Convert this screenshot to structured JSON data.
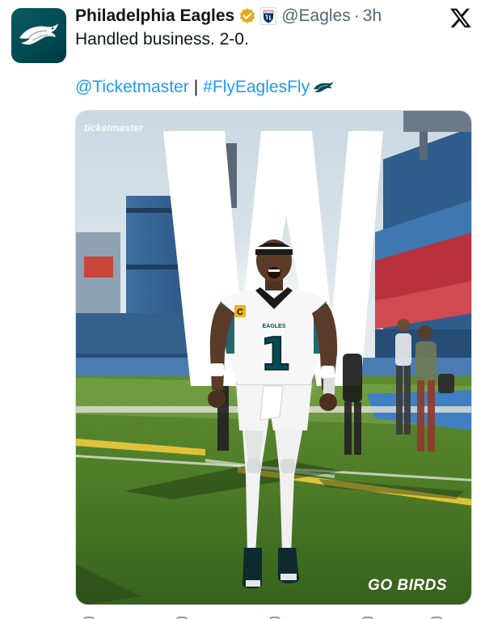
{
  "tweet": {
    "author": {
      "display_name": "Philadelphia Eagles",
      "handle": "@Eagles",
      "verified_badge": "gold-check",
      "affiliate_badge": "nfl-shield",
      "avatar_icon": "eagles-logo-icon"
    },
    "separator": "·",
    "timestamp": "3h",
    "platform_icon": "x-logo-icon",
    "text": "Handled business. 2-0.",
    "links": {
      "mention": "@Ticketmaster",
      "divider": "|",
      "hashtag": "#FlyEaglesFly",
      "hashtag_icon": "eagles-wing-icon"
    },
    "media": {
      "brand_watermark": "ticketmaster",
      "tagline": "GO BIRDS",
      "big_letter": "W",
      "jersey_number": "1",
      "jersey_wordmark": "EAGLES",
      "captain_patch": "C"
    }
  },
  "colors": {
    "link": "#1d9bf0",
    "muted": "#536471",
    "eagles_green": "#004c54",
    "verified_gold": "#e8a91b"
  }
}
